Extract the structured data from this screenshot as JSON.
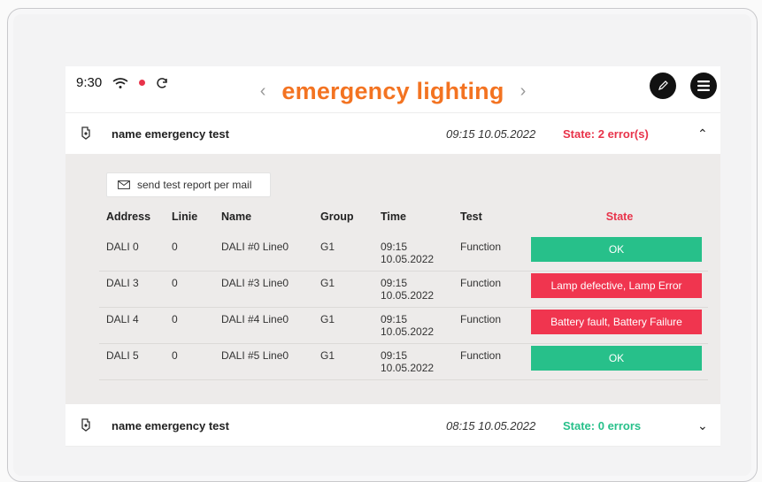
{
  "status_bar": {
    "time": "9:30"
  },
  "header": {
    "title": "emergency lighting",
    "prev": "‹",
    "next": "›"
  },
  "icons": {
    "wifi": "wifi-icon",
    "recording": "record-dot-icon",
    "sync": "sync-icon",
    "edit": "pencil-icon",
    "menu": "menu-icon",
    "test": "test-icon",
    "mail": "mail-icon"
  },
  "colors": {
    "accent": "#f37321",
    "error": "#e8334a",
    "ok": "#27c08a"
  },
  "panels": [
    {
      "name": "name emergency test",
      "time": "09:15  10.05.2022",
      "state": "State: 2 error(s)",
      "toggle": "⌃"
    },
    {
      "name": "name emergency test",
      "time": "08:15 10.05.2022",
      "state": "State: 0 errors",
      "toggle": "⌄"
    }
  ],
  "report": {
    "button_label": "send test report per mail"
  },
  "table": {
    "headers": [
      "Address",
      "Linie",
      "Name",
      "Group",
      "Time",
      "Test",
      "State"
    ],
    "rows": [
      {
        "address": "DALI 0",
        "linie": "0",
        "name": "DALI #0 Line0",
        "group": "G1",
        "time1": "09:15",
        "time2": "10.05.2022",
        "test": "Function",
        "state": "OK"
      },
      {
        "address": "DALI 3",
        "linie": "0",
        "name": "DALI #3 Line0",
        "group": "G1",
        "time1": "09:15",
        "time2": "10.05.2022",
        "test": "Function",
        "state": "Lamp defective, Lamp Error"
      },
      {
        "address": "DALI 4",
        "linie": "0",
        "name": "DALI #4 Line0",
        "group": "G1",
        "time1": "09:15",
        "time2": "10.05.2022",
        "test": "Function",
        "state": "Battery fault, Battery Failure"
      },
      {
        "address": "DALI 5",
        "linie": "0",
        "name": "DALI #5 Line0",
        "group": "G1",
        "time1": "09:15",
        "time2": "10.05.2022",
        "test": "Function",
        "state": "OK"
      }
    ]
  }
}
